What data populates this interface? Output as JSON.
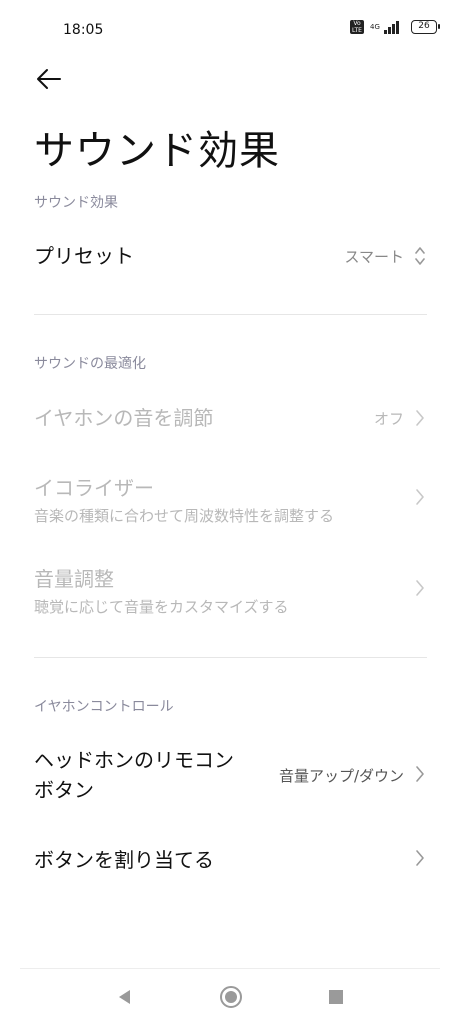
{
  "status_bar": {
    "time": "18:05",
    "volte": "Vo LTE",
    "network": "4G",
    "battery": "26"
  },
  "header": {
    "title": "サウンド効果"
  },
  "sections": {
    "sound_effects": {
      "header": "サウンド効果",
      "preset": {
        "title": "プリセット",
        "value": "スマート"
      }
    },
    "optimization": {
      "header": "サウンドの最適化",
      "earphone_tuning": {
        "title": "イヤホンの音を調節",
        "value": "オフ"
      },
      "equalizer": {
        "title": "イコライザー",
        "subtitle": "音楽の種類に合わせて周波数特性を調整する"
      },
      "volume_adjust": {
        "title": "音量調整",
        "subtitle": "聴覚に応じて音量をカスタマイズする"
      }
    },
    "earphone_control": {
      "header": "イヤホンコントロール",
      "remote_button": {
        "title_line1": "ヘッドホンのリモコン",
        "title_line2": "ボタン",
        "value": "音量アップ/ダウン"
      },
      "assign_buttons": {
        "title": "ボタンを割り当てる"
      }
    }
  },
  "colors": {
    "text_primary": "#111111",
    "text_disabled": "#b8b8b8",
    "section_header": "#8a8a9c",
    "divider": "#e6e6e6"
  },
  "nav": {
    "back_icon": "triangle-back-icon",
    "home_icon": "circle-home-icon",
    "recents_icon": "square-recents-icon"
  }
}
